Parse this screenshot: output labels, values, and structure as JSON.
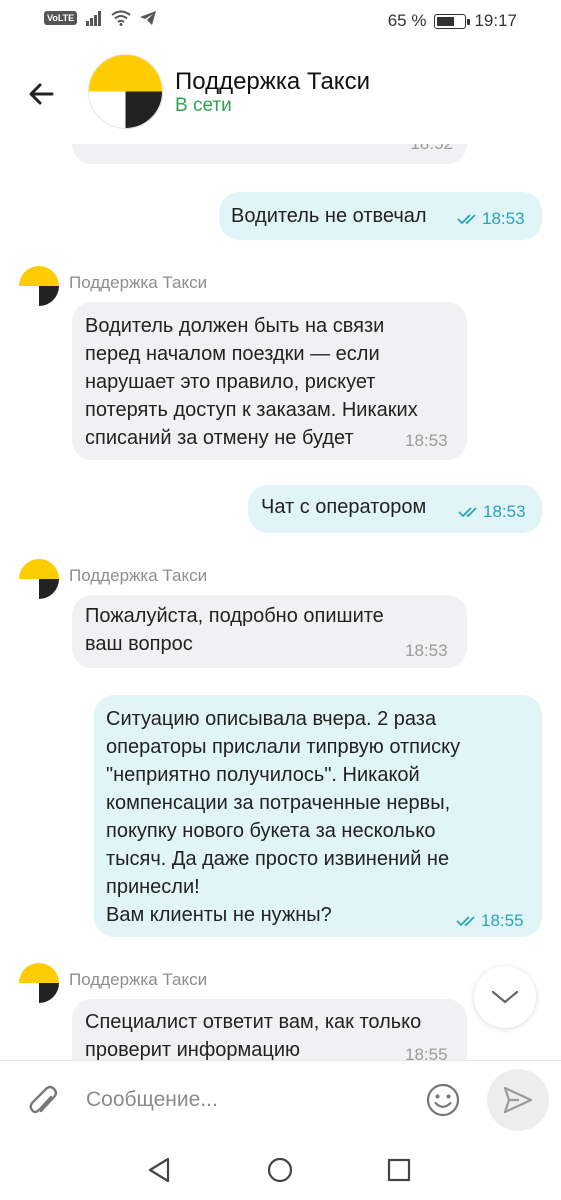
{
  "status_bar": {
    "volte": "VoLTE",
    "battery": "65 %",
    "battery_level": 0.65,
    "time": "19:17"
  },
  "header": {
    "title": "Поддержка Такси",
    "status": "В сети"
  },
  "messages": [
    {
      "from": "support",
      "text": "",
      "time": "18:52"
    },
    {
      "from": "me",
      "text": "Водитель не отвечал",
      "time": "18:53"
    },
    {
      "from": "support",
      "sender": "Поддержка Такси",
      "lines": [
        "Водитель должен быть на связи",
        "перед началом поездки — если",
        "нарушает это правило, рискует",
        "потерять доступ к заказам. Никаких",
        "списаний за отмену не будет"
      ],
      "time": "18:53"
    },
    {
      "from": "me",
      "text": "Чат с оператором",
      "time": "18:53"
    },
    {
      "from": "support",
      "sender": "Поддержка Такси",
      "lines": [
        "Пожалуйста, подробно опишите",
        "ваш вопрос"
      ],
      "time": "18:53"
    },
    {
      "from": "me",
      "lines": [
        "Ситуацию описывала вчера. 2 раза",
        "операторы прислали типрвую отписку",
        "\"неприятно получилось\". Никакой",
        "компенсации за потраченные нервы,",
        "покупку нового букета за несколько",
        "тысяч. Да даже просто извинений не",
        "принесли!",
        "Вам клиенты не нужны?"
      ],
      "time": "18:55"
    },
    {
      "from": "support",
      "sender": "Поддержка Такси",
      "lines": [
        "Специалист ответит вам, как только",
        "проверит информацию"
      ],
      "time": "18:55"
    }
  ],
  "input": {
    "placeholder": "Сообщение..."
  },
  "colors": {
    "online": "#2ea44f",
    "outgoing_bubble": "#e1f4f8",
    "incoming_bubble": "#f1f1f3",
    "read_ticks": "#2aa3b5",
    "brand_yellow": "#ffcc00"
  }
}
